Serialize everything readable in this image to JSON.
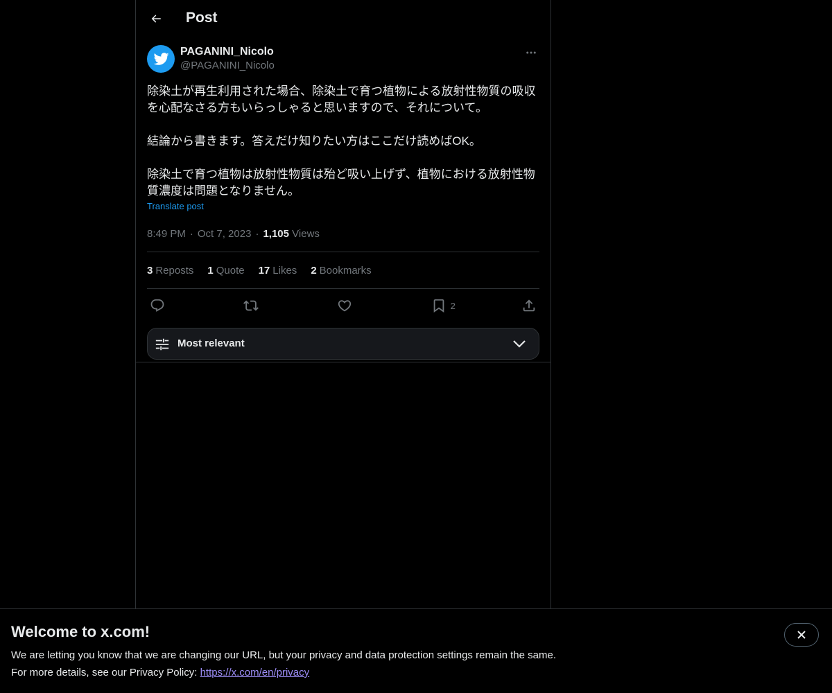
{
  "header": {
    "title": "Post",
    "back_icon": "arrow-left-icon"
  },
  "author": {
    "name": "PAGANINI_Nicolo",
    "handle": "@PAGANINI_Nicolo",
    "avatar_icon": "twitter-bird-icon",
    "avatar_color": "#1d9bf0"
  },
  "post": {
    "text_p1": "除染土が再生利用された場合、除染土で育つ植物による放射性物質の吸収を心配なさる方もいらっしゃると思いますので、それについて。",
    "text_p2": "結論から書きます。答えだけ知りたい方はここだけ読めばOK。",
    "text_p3": "除染土で育つ植物は放射性物質は殆ど吸い上げず、植物における放射性物質濃度は問題となりません。",
    "translate_label": "Translate post",
    "time": "8:49 PM",
    "date": "Oct 7, 2023",
    "views_count": "1,105",
    "views_label": "Views"
  },
  "stats": [
    {
      "count": "3",
      "label": "Reposts"
    },
    {
      "count": "1",
      "label": "Quote"
    },
    {
      "count": "17",
      "label": "Likes"
    },
    {
      "count": "2",
      "label": "Bookmarks"
    }
  ],
  "actions": {
    "reply_icon": "reply-icon",
    "repost_icon": "repost-icon",
    "like_icon": "heart-icon",
    "bookmark_icon": "bookmark-icon",
    "bookmark_count": "2",
    "share_icon": "share-icon"
  },
  "sort": {
    "label": "Most relevant"
  },
  "banner": {
    "title": "Welcome to x.com!",
    "line1": "We are letting you know that we are changing our URL, but your privacy and data protection settings remain the same.",
    "line2_prefix": "For more details, see our Privacy Policy: ",
    "link_text": "https://x.com/en/privacy"
  },
  "colors": {
    "background": "#000000",
    "accent": "#1d9bf0",
    "text": "#e7e9ea",
    "muted": "#71767b",
    "link": "#9b8cf5"
  }
}
